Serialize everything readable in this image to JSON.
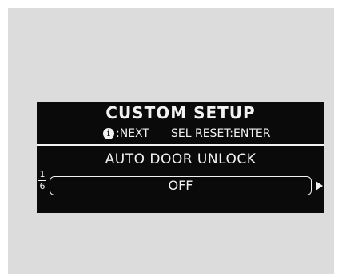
{
  "screen": {
    "title": "CUSTOM SETUP",
    "hint_next_icon": "info-icon",
    "hint_next_label": ":NEXT",
    "hint_reset": "SEL RESET:ENTER",
    "item_title": "AUTO DOOR UNLOCK",
    "page_current": "1",
    "page_total": "6",
    "value": "OFF",
    "next_arrow_icon": "arrow-right-icon"
  }
}
